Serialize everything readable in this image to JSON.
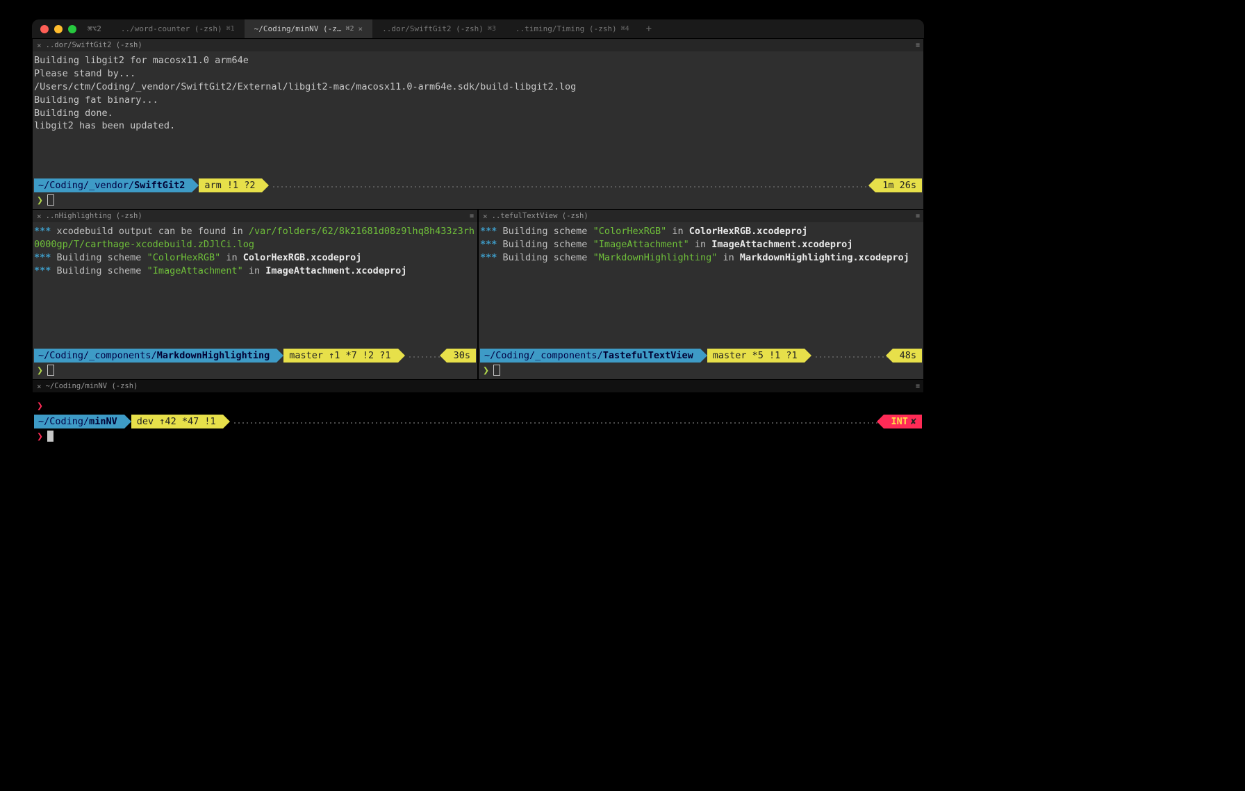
{
  "window_badge": "⌘⌥2",
  "tabs": [
    {
      "label": "../word-counter (-zsh)",
      "shortcut": "⌘1"
    },
    {
      "label": "~/Coding/minNV (-z…",
      "shortcut": "⌘2"
    },
    {
      "label": "..dor/SwiftGit2 (-zsh)",
      "shortcut": "⌘3"
    },
    {
      "label": "..timing/Timing (-zsh)",
      "shortcut": "⌘4"
    }
  ],
  "panes": {
    "top": {
      "title": "..dor/SwiftGit2 (-zsh)",
      "output": [
        "Building libgit2 for macosx11.0 arm64e",
        "Please stand by...",
        "/Users/ctm/Coding/_vendor/SwiftGit2/External/libgit2-mac/macosx11.0-arm64e.sdk/build-libgit2.log",
        "Building fat binary...",
        "Building done.",
        "libgit2 has been updated."
      ],
      "prompt": {
        "path_prefix": "~/Coding/_vendor/",
        "path_bold": "SwiftGit2",
        "branch_info": "arm !1 ?2",
        "timer": "1m 26s"
      }
    },
    "mid_left": {
      "title": "..nHighlighting (-zsh)",
      "lines": {
        "l1a": "xcodebuild output can be found in ",
        "l1b": "/var/folders/62/8k21681d08z9lhq8h433z3rh0000gp/T/carthage-xcodebuild.zDJlCi.log",
        "l2a": "Building scheme ",
        "l2b": "\"ColorHexRGB\"",
        "l2c": " in ",
        "l2d": "ColorHexRGB.xcodeproj",
        "l3a": "Building scheme ",
        "l3b": "\"ImageAttachment\"",
        "l3c": " in ",
        "l3d": "ImageAttachment.xcodeproj"
      },
      "prompt": {
        "path_prefix": "~/Coding/_components/",
        "path_bold": "MarkdownHighlighting",
        "branch_info": "master ↑1 *7 !2 ?1",
        "timer": "30s"
      }
    },
    "mid_right": {
      "title": "..tefulTextView (-zsh)",
      "lines": {
        "l1a": "Building scheme ",
        "l1b": "\"ColorHexRGB\"",
        "l1c": " in ",
        "l1d": "ColorHexRGB.xcodeproj",
        "l2a": "Building scheme ",
        "l2b": "\"ImageAttachment\"",
        "l2c": " in ",
        "l2d": "ImageAttachment.xcodeproj",
        "l3a": "Building scheme ",
        "l3b": "\"MarkdownHighlighting\"",
        "l3c": " in ",
        "l3d": "MarkdownHighlighting.xcodeproj"
      },
      "prompt": {
        "path_prefix": "~/Coding/_components/",
        "path_bold": "TastefulTextView",
        "branch_info": "master *5 !1 ?1",
        "timer": "48s"
      }
    },
    "bottom": {
      "title": "~/Coding/minNV (-zsh)",
      "prompt": {
        "path_prefix": "~/Coding/",
        "path_bold": "minNV",
        "branch_info": "dev ↑42 *47 !1",
        "status": "INT",
        "status_x": "✘"
      }
    }
  }
}
